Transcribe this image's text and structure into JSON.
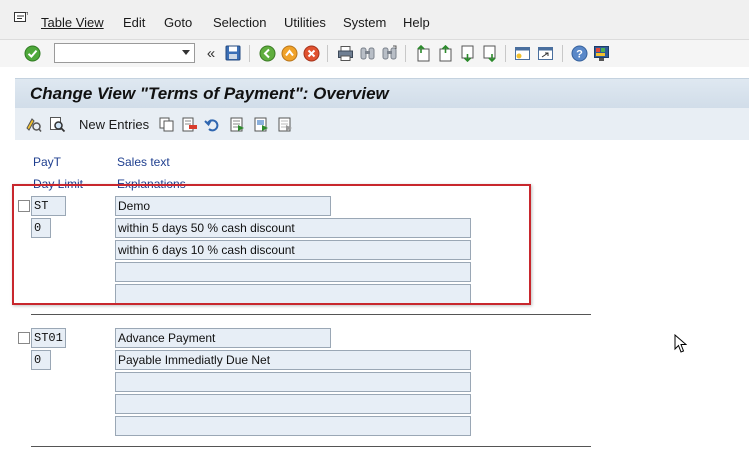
{
  "menu": {
    "items": [
      {
        "label": "Table View"
      },
      {
        "label": "Edit"
      },
      {
        "label": "Goto"
      },
      {
        "label": "Selection"
      },
      {
        "label": "Utilities"
      },
      {
        "label": "System"
      },
      {
        "label": "Help"
      }
    ]
  },
  "toolbar": {
    "command_field_value": "",
    "back_label": "«"
  },
  "title": "Change View \"Terms of Payment\": Overview",
  "app_toolbar": {
    "new_entries_label": "New Entries"
  },
  "columns": {
    "payt": "PayT",
    "sales_text": "Sales text",
    "day_limit": "Day Limit",
    "explanations": "Explanations"
  },
  "entries": [
    {
      "payt": "ST",
      "day_limit": "0",
      "sales_text": "Demo",
      "explanations": [
        "within 5 days 50 % cash discount",
        "within 6 days 10 % cash discount",
        "",
        ""
      ]
    },
    {
      "payt": "ST01",
      "day_limit": "0",
      "sales_text": "Advance Payment",
      "explanations": [
        "Payable Immediatly Due Net",
        "",
        "",
        ""
      ]
    }
  ],
  "colors": {
    "highlight": "#c8272d",
    "title_bar": "#d8e3ee",
    "field_bg": "#e7eef6",
    "column_header": "#1f3f8f"
  }
}
